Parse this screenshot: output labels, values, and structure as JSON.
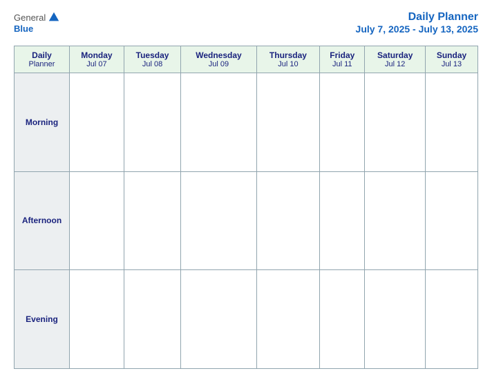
{
  "header": {
    "logo": {
      "general": "General",
      "blue": "Blue",
      "icon_alt": "GeneralBlue logo"
    },
    "title": "Daily Planner",
    "date_range": "July 7, 2025 - July 13, 2025"
  },
  "table": {
    "label_column": {
      "header_line1": "Daily",
      "header_line2": "Planner"
    },
    "days": [
      {
        "name": "Monday",
        "date": "Jul 07"
      },
      {
        "name": "Tuesday",
        "date": "Jul 08"
      },
      {
        "name": "Wednesday",
        "date": "Jul 09"
      },
      {
        "name": "Thursday",
        "date": "Jul 10"
      },
      {
        "name": "Friday",
        "date": "Jul 11"
      },
      {
        "name": "Saturday",
        "date": "Jul 12"
      },
      {
        "name": "Sunday",
        "date": "Jul 13"
      }
    ],
    "time_slots": [
      "Morning",
      "Afternoon",
      "Evening"
    ]
  }
}
